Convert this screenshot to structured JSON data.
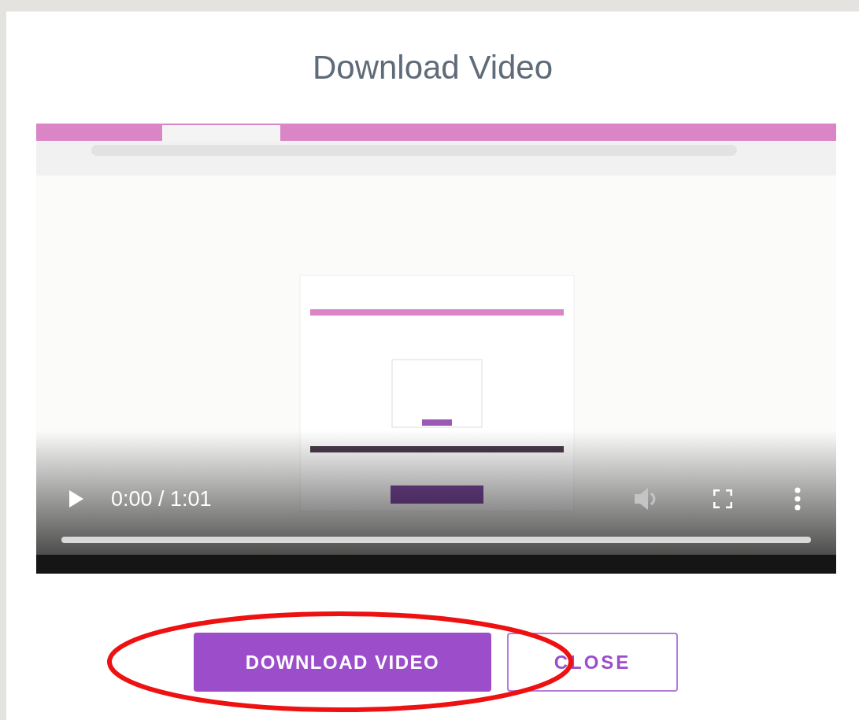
{
  "dialog": {
    "title": "Download Video"
  },
  "video": {
    "controls": {
      "time": "0:00 / 1:01"
    }
  },
  "buttons": [
    {
      "label": "DOWNLOAD VIDEO",
      "kind": "primary",
      "circled": true
    },
    {
      "label": "CLOSE",
      "kind": "outline",
      "circled": false
    }
  ]
}
